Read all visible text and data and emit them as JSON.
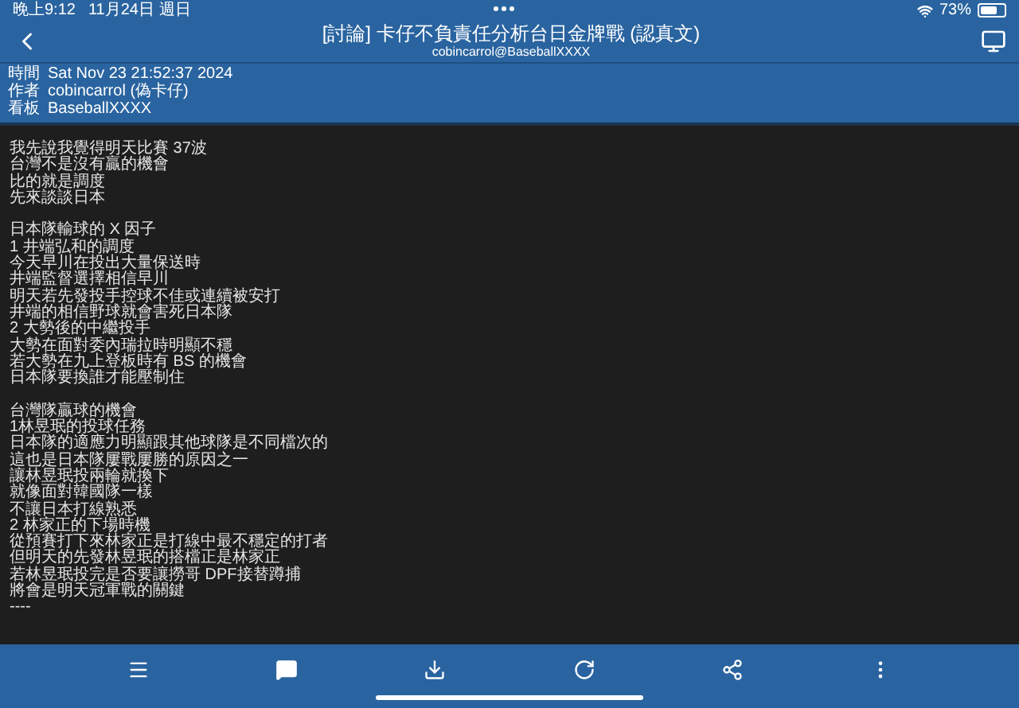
{
  "status_bar": {
    "time": "晚上9:12",
    "date": "11月24日 週日",
    "battery": "73%"
  },
  "header": {
    "title": "[討論] 卡仔不負責任分析台日金牌戰 (認真文)",
    "subtitle": "cobincarrol@BaseballXXXX"
  },
  "meta": [
    {
      "label": "時間",
      "value": "Sat Nov 23 21:52:37 2024"
    },
    {
      "label": "作者",
      "value": "cobincarrol (偽卡仔)"
    },
    {
      "label": "看板",
      "value": "BaseballXXXX"
    }
  ],
  "paragraphs": [
    [
      "我先說我覺得明天比賽 37波",
      "台灣不是沒有贏的機會",
      "比的就是調度",
      "先來談談日本"
    ],
    [
      "日本隊輸球的 X 因子",
      "1 井端弘和的調度",
      "今天早川在投出大量保送時",
      "井端監督選擇相信早川",
      "明天若先發投手控球不佳或連續被安打",
      "井端的相信野球就會害死日本隊",
      "2 大勢後的中繼投手",
      "大勢在面對委內瑞拉時明顯不穩",
      "若大勢在九上登板時有 BS 的機會",
      "日本隊要換誰才能壓制住"
    ],
    [
      "台灣隊贏球的機會",
      "1林昱珉的投球任務",
      "日本隊的適應力明顯跟其他球隊是不同檔次的",
      "這也是日本隊屢戰屢勝的原因之一",
      "讓林昱珉投兩輪就換下",
      "就像面對韓國隊一樣",
      "不讓日本打線熟悉",
      "2 林家正的下場時機",
      "從預賽打下來林家正是打線中最不穩定的打者",
      "但明天的先發林昱珉的搭檔正是林家正",
      "若林昱珉投完是否要讓撈哥 DPF接替蹲捕",
      "將會是明天冠軍戰的關鍵",
      "----"
    ]
  ]
}
